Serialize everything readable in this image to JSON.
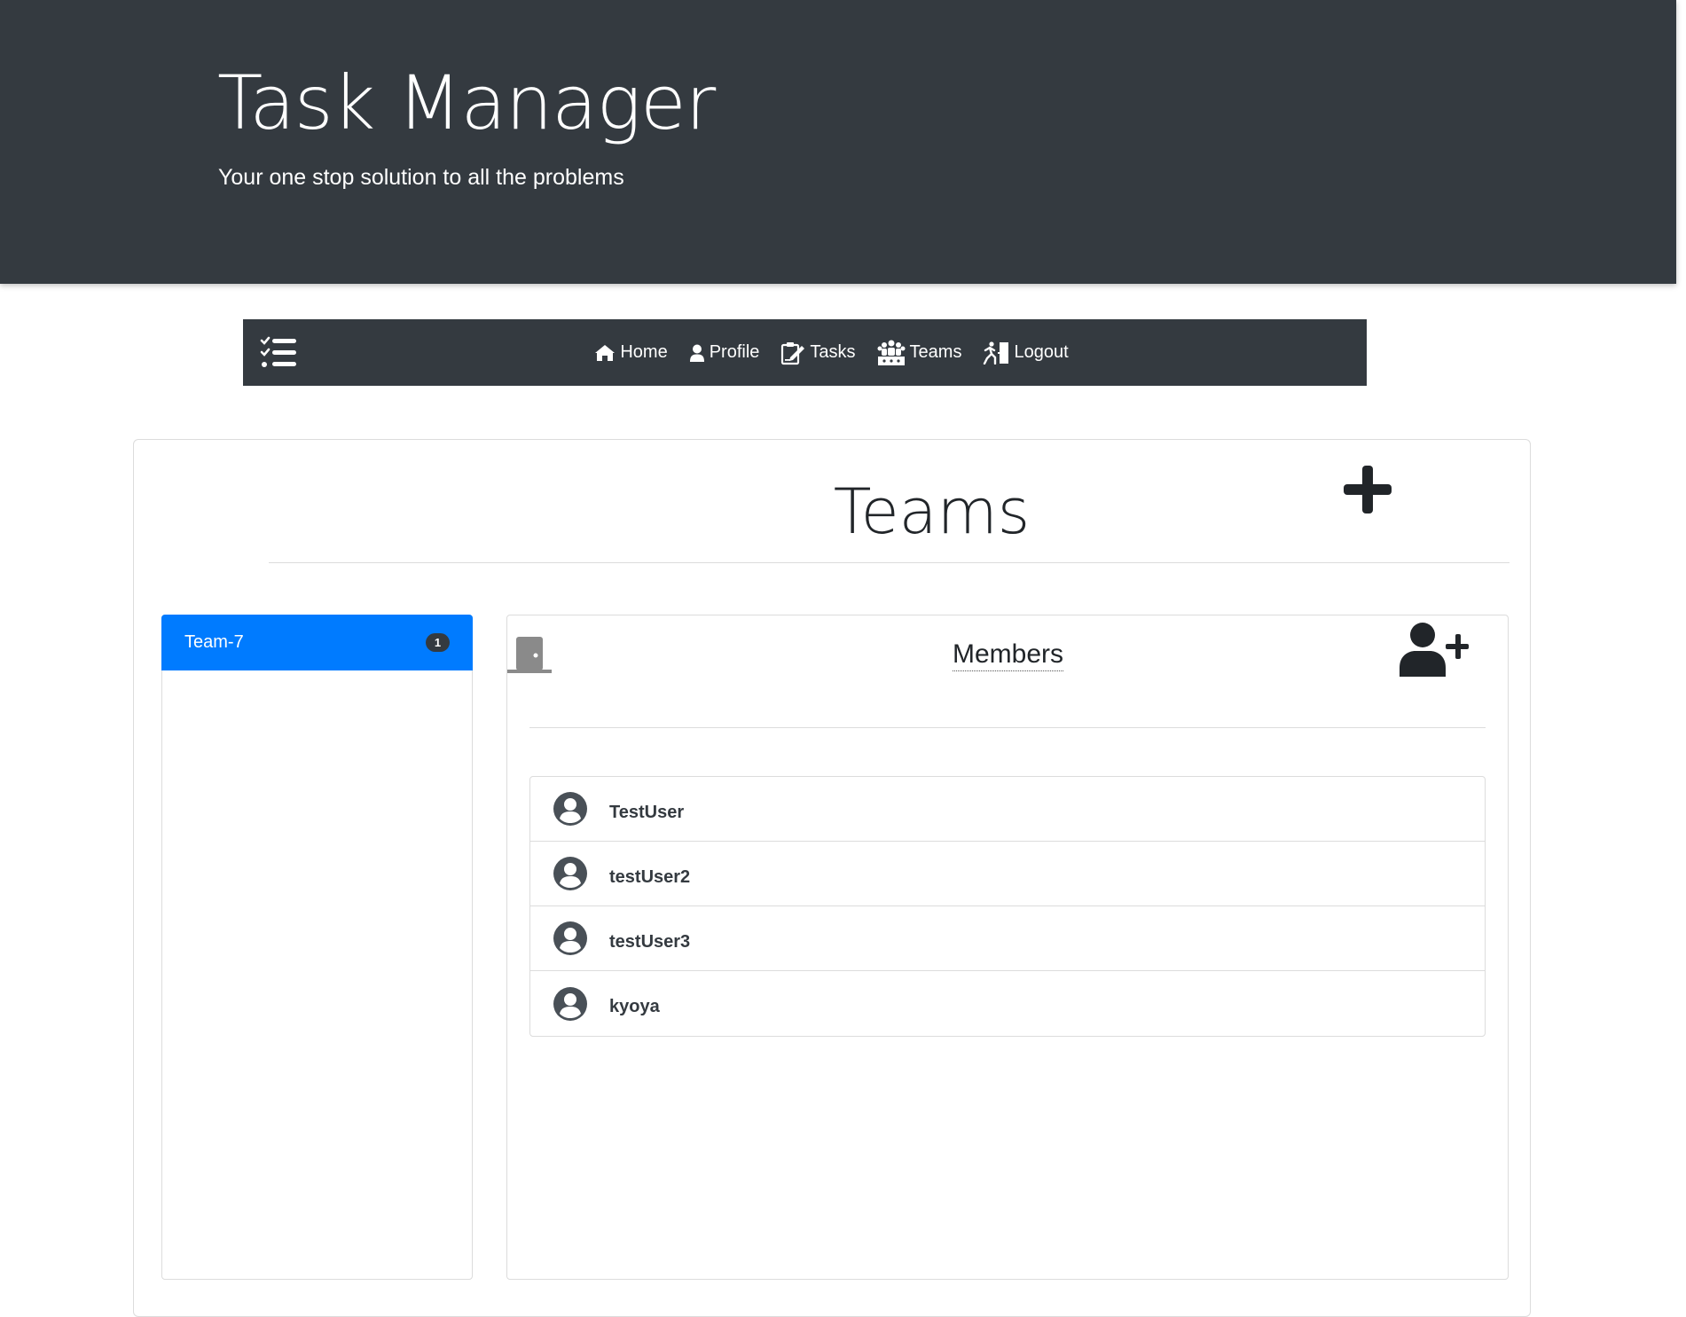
{
  "header": {
    "title": "Task Manager",
    "subtitle": "Your one stop solution to all the problems"
  },
  "navbar": {
    "brand_icon": "checklist-icon",
    "links": [
      {
        "label": "Home",
        "icon": "home-icon"
      },
      {
        "label": "Profile",
        "icon": "user-icon"
      },
      {
        "label": "Tasks",
        "icon": "clipboard-edit-icon"
      },
      {
        "label": "Teams",
        "icon": "people-group-icon"
      },
      {
        "label": "Logout",
        "icon": "running-exit-icon"
      }
    ]
  },
  "main": {
    "title": "Teams",
    "add_team_icon": "plus-icon"
  },
  "teams": {
    "items": [
      {
        "name": "Team-7",
        "count": "1",
        "active": true
      }
    ]
  },
  "members": {
    "title": "Members",
    "leave_icon": "door-icon",
    "add_member_icon": "user-plus-icon",
    "list": [
      {
        "name": "TestUser"
      },
      {
        "name": "testUser2"
      },
      {
        "name": "testUser3"
      },
      {
        "name": "kyoya"
      }
    ]
  },
  "colors": {
    "dark": "#343a40",
    "primary": "#007bff",
    "border": "#dcdcdc"
  }
}
